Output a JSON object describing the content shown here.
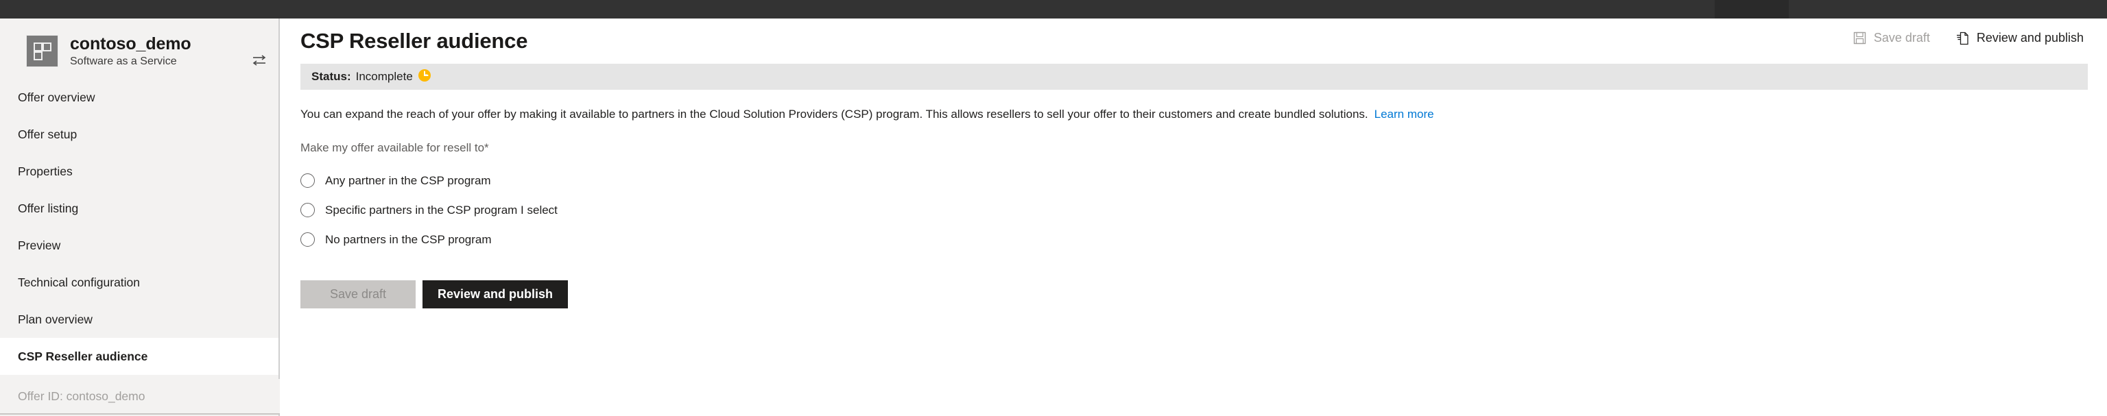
{
  "offer": {
    "name": "contoso_demo",
    "type": "Software as a Service",
    "icon": "saas-grid-icon",
    "switch_icon": "switch-offer-icon",
    "footer": "Offer ID: contoso_demo"
  },
  "sidebar": {
    "items": [
      {
        "label": "Offer overview",
        "selected": false
      },
      {
        "label": "Offer setup",
        "selected": false
      },
      {
        "label": "Properties",
        "selected": false
      },
      {
        "label": "Offer listing",
        "selected": false
      },
      {
        "label": "Preview",
        "selected": false
      },
      {
        "label": "Technical configuration",
        "selected": false
      },
      {
        "label": "Plan overview",
        "selected": false
      },
      {
        "label": "CSP Reseller audience",
        "selected": true
      }
    ]
  },
  "header": {
    "title": "CSP Reseller audience",
    "commands": [
      {
        "label": "Save draft",
        "icon": "save-floppy-icon",
        "disabled": true
      },
      {
        "label": "Review and publish",
        "icon": "publish-document-icon",
        "disabled": false
      }
    ]
  },
  "status": {
    "label": "Status:",
    "value": "Incomplete",
    "icon": "incomplete-clock-icon",
    "icon_color": "#ffb900"
  },
  "main": {
    "description": "You can expand the reach of your offer by making it available to partners in the Cloud Solution Providers (CSP) program. This allows resellers to sell your offer to their customers and create bundled solutions.",
    "learn_more": "Learn more",
    "field_label": "Make my offer available for resell to",
    "required_marker": "*",
    "options": [
      {
        "label": "Any partner in the CSP program",
        "selected": false
      },
      {
        "label": "Specific partners in the CSP program I select",
        "selected": false
      },
      {
        "label": "No partners in the CSP program",
        "selected": false
      }
    ],
    "buttons": {
      "save_draft": "Save draft",
      "review_publish": "Review and publish"
    }
  },
  "colors": {
    "accent_link": "#0078d4",
    "status_warning": "#ffb900",
    "primary_button": "#201f1e",
    "chrome": "#333333"
  }
}
